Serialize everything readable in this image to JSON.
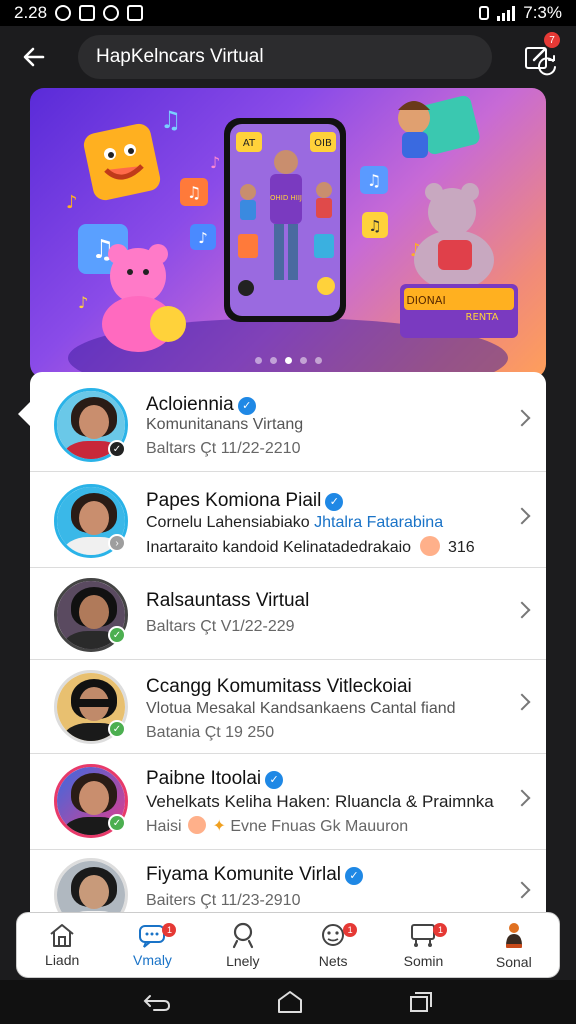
{
  "status_bar": {
    "time": "2.28",
    "battery": "7:3%"
  },
  "app_bar": {
    "title": "HapKelncars Virtual",
    "edit_badge": "7"
  },
  "hero": {
    "phone_tag_left": "AT",
    "phone_tag_right": "OIB",
    "shirt_text": "OHID HIIJ",
    "pedestal_left": "DIONAI",
    "pedestal_right": "RENTA"
  },
  "list": [
    {
      "title": "Acloiennia",
      "verified": true,
      "line1": "Komunitanans Virtang",
      "line2": "Baltars Çt 11/22-2210",
      "status_color": "#222"
    },
    {
      "title": "Papes Komiona Piail",
      "verified": true,
      "line1_a": "Cornelu Lahensiabiako ",
      "line1_b": "Jhtalra Fatarabina",
      "line2": "Inartaraito kandoid Kelinatadedrakaio",
      "line2_count": "316",
      "status_color": "#9e9e9e"
    },
    {
      "title": "Ralsauntass Virtual",
      "verified": false,
      "line1": "Baltars Çt V1/22-229",
      "status_color": "#4caf50"
    },
    {
      "title": "Ccangg Komumitass Vitleckoiai",
      "verified": false,
      "line1": "Vlotua Mesakal Kandsankaens Cantal fiand",
      "line2": "Batania Çt 19 250",
      "status_color": "#4caf50"
    },
    {
      "title": "Paibne Itoolai",
      "verified": true,
      "line1": "Vehelkats Keliha Haken: Rluancla & Praimnka",
      "line2": "Evne Fnuas Gk Mauuron",
      "line2_prefix": "Haisi",
      "status_color": "#4caf50"
    },
    {
      "title": "Fiyama Komunite Virlal",
      "verified": true,
      "line1": "Baiters Çt 11/23-2910",
      "status_color": "#4caf50"
    }
  ],
  "bottom_nav": [
    {
      "label": "Liadn",
      "icon": "home-icon",
      "badge": ""
    },
    {
      "label": "Vmaly",
      "icon": "chat-icon",
      "badge": "1"
    },
    {
      "label": "Lnely",
      "icon": "search-icon",
      "badge": ""
    },
    {
      "label": "Nets",
      "icon": "group-icon",
      "badge": "1"
    },
    {
      "label": "Somin",
      "icon": "cart-icon",
      "badge": "1"
    },
    {
      "label": "Sonal",
      "icon": "profile-icon",
      "badge": ""
    }
  ],
  "colors": {
    "accent": "#1a73c7",
    "badge": "#e53935",
    "verified": "#1f88e5",
    "ring": "#2ab3e8"
  }
}
